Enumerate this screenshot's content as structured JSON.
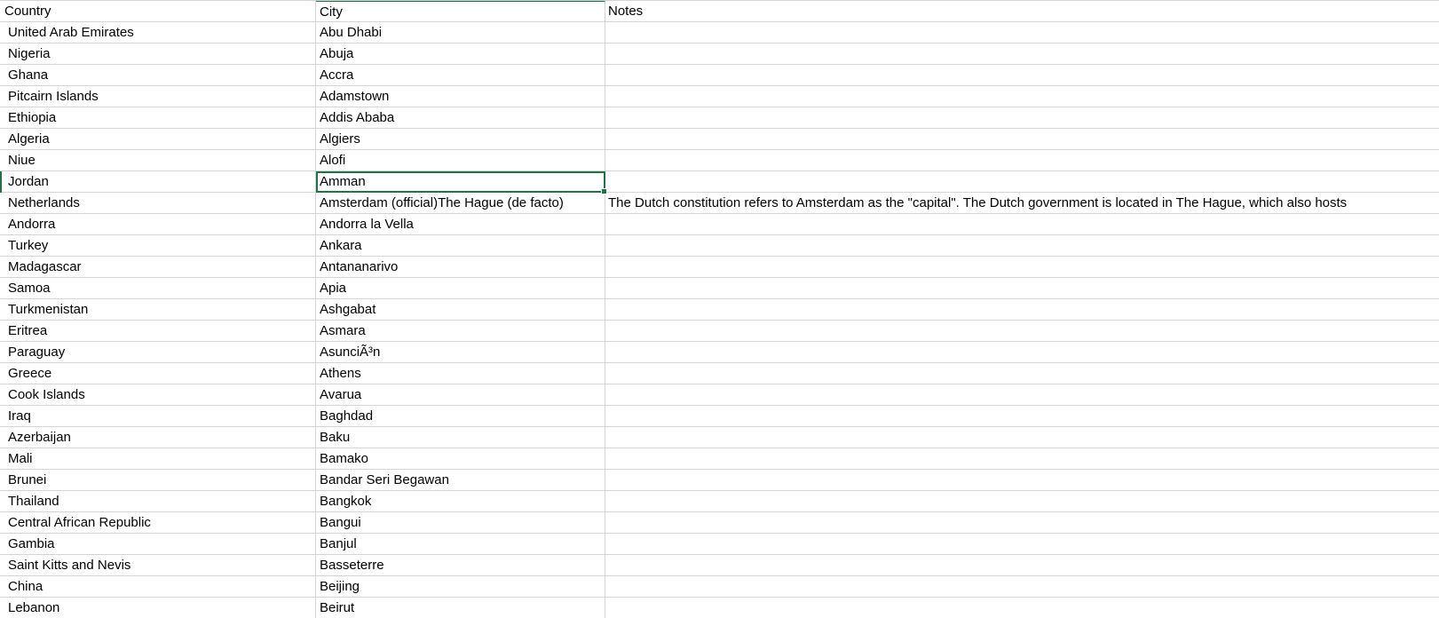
{
  "headers": {
    "country": "Country",
    "city": "City",
    "notes": "Notes"
  },
  "rows": [
    {
      "country": "United Arab Emirates",
      "city": "Abu Dhabi",
      "notes": ""
    },
    {
      "country": "Nigeria",
      "city": "Abuja",
      "notes": ""
    },
    {
      "country": "Ghana",
      "city": "Accra",
      "notes": ""
    },
    {
      "country": "Pitcairn Islands",
      "city": "Adamstown",
      "notes": ""
    },
    {
      "country": "Ethiopia",
      "city": "Addis Ababa",
      "notes": ""
    },
    {
      "country": "Algeria",
      "city": "Algiers",
      "notes": ""
    },
    {
      "country": "Niue",
      "city": "Alofi",
      "notes": ""
    },
    {
      "country": "Jordan",
      "city": "Amman",
      "notes": ""
    },
    {
      "country": "Netherlands",
      "city": "Amsterdam (official)The Hague (de facto)",
      "notes": "The Dutch constitution refers to Amsterdam as the \"capital\". The Dutch government is located in The Hague, which also hosts"
    },
    {
      "country": "Andorra",
      "city": "Andorra la Vella",
      "notes": ""
    },
    {
      "country": "Turkey",
      "city": "Ankara",
      "notes": ""
    },
    {
      "country": "Madagascar",
      "city": "Antananarivo",
      "notes": ""
    },
    {
      "country": "Samoa",
      "city": "Apia",
      "notes": ""
    },
    {
      "country": "Turkmenistan",
      "city": "Ashgabat",
      "notes": ""
    },
    {
      "country": "Eritrea",
      "city": "Asmara",
      "notes": ""
    },
    {
      "country": "Paraguay",
      "city": "AsunciÃ³n",
      "notes": ""
    },
    {
      "country": "Greece",
      "city": "Athens",
      "notes": ""
    },
    {
      "country": "Cook Islands",
      "city": "Avarua",
      "notes": ""
    },
    {
      "country": "Iraq",
      "city": "Baghdad",
      "notes": ""
    },
    {
      "country": "Azerbaijan",
      "city": "Baku",
      "notes": ""
    },
    {
      "country": "Mali",
      "city": "Bamako",
      "notes": ""
    },
    {
      "country": "Brunei",
      "city": "Bandar Seri Begawan",
      "notes": ""
    },
    {
      "country": "Thailand",
      "city": "Bangkok",
      "notes": ""
    },
    {
      "country": "Central African Republic",
      "city": "Bangui",
      "notes": ""
    },
    {
      "country": "Gambia",
      "city": "Banjul",
      "notes": ""
    },
    {
      "country": "Saint Kitts and Nevis",
      "city": "Basseterre",
      "notes": ""
    },
    {
      "country": "China",
      "city": "Beijing",
      "notes": ""
    },
    {
      "country": "Lebanon",
      "city": "Beirut",
      "notes": ""
    }
  ],
  "selection": {
    "row_index": 7,
    "column": "city"
  },
  "colors": {
    "gridline": "#d4d4d4",
    "selection": "#217346"
  }
}
